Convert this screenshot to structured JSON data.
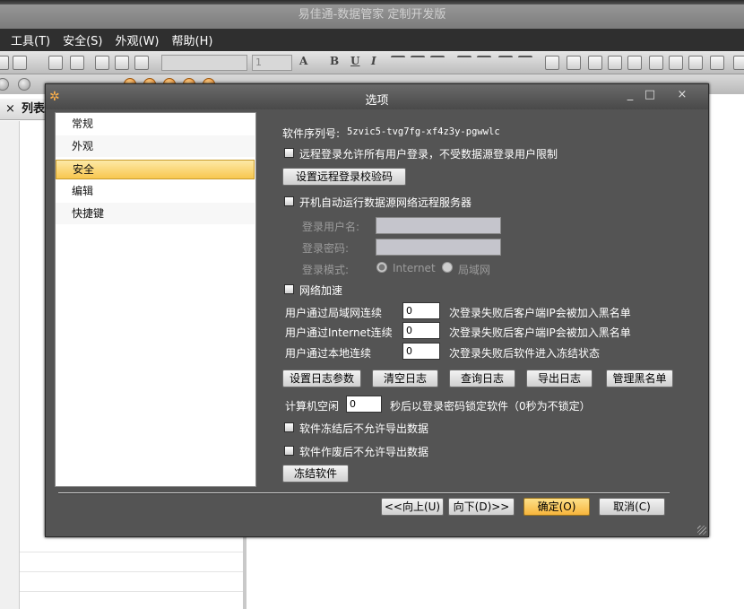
{
  "app": {
    "title": "易佳通-数据管家 定制开发版",
    "menu": [
      "工具(T)",
      "安全(S)",
      "外观(W)",
      "帮助(H)"
    ],
    "toolbar_font_size": "1",
    "left_pane_title": "列表",
    "left_pane_close": "×"
  },
  "dialog": {
    "title": "选项",
    "controls": {
      "minimize": "_",
      "maximize": "□",
      "close": "×"
    },
    "nav": [
      "常规",
      "外观",
      "安全",
      "编辑",
      "快捷键"
    ],
    "selected_nav": "安全",
    "serial": {
      "label": "软件序列号:",
      "value": "5zvic5-tvg7fg-xf4z3y-pgwwlc"
    },
    "remote_login_all_users": {
      "label": "远程登录允许所有用户登录，不受数据源登录用户限制",
      "checked": false
    },
    "set_remote_code_button": "设置远程登录校验码",
    "auto_start_server": {
      "label": "开机自动运行数据源网络远程服务器",
      "checked": false
    },
    "login_user_label": "登录用户名:",
    "login_pass_label": "登录密码:",
    "login_mode_label": "登录模式:",
    "login_mode_options": [
      "Internet",
      "局域网"
    ],
    "login_mode_selected": "Internet",
    "network_accel": {
      "label": "网络加速",
      "checked": false
    },
    "lan_fail": {
      "prefix": "用户通过局域网连续",
      "value": "0",
      "suffix": "次登录失败后客户端IP会被加入黑名单"
    },
    "internet_fail": {
      "prefix": "用户通过Internet连续",
      "value": "0",
      "suffix": "次登录失败后客户端IP会被加入黑名单"
    },
    "local_fail": {
      "prefix": "用户通过本地连续",
      "value": "0",
      "suffix": "次登录失败后软件进入冻结状态"
    },
    "log_buttons": [
      "设置日志参数",
      "清空日志",
      "查询日志",
      "导出日志",
      "管理黑名单"
    ],
    "idle": {
      "prefix": "计算机空闲",
      "value": "0",
      "suffix": "秒后以登录密码锁定软件（0秒为不锁定）"
    },
    "no_export_frozen": {
      "label": "软件冻结后不允许导出数据",
      "checked": false
    },
    "no_export_void": {
      "label": "软件作废后不允许导出数据",
      "checked": false
    },
    "freeze_button": "冻结软件",
    "footer_buttons": {
      "prev": "<<向上(U)",
      "next": "向下(D)>>",
      "ok": "确定(O)",
      "cancel": "取消(C)"
    }
  }
}
